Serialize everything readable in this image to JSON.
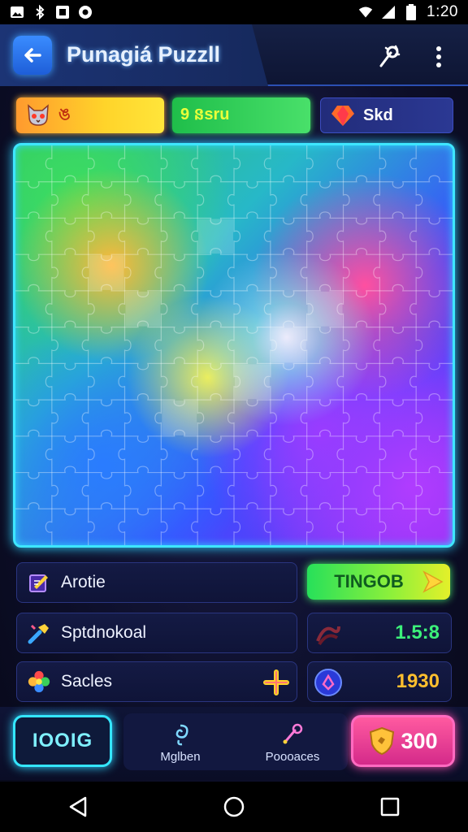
{
  "status_bar": {
    "time": "1:20",
    "icons": [
      "image-icon",
      "bluetooth-icon",
      "gallery-icon",
      "location-icon",
      "wifi-icon",
      "signal-icon",
      "battery-icon"
    ]
  },
  "header": {
    "title": "Punagiá Puzzll",
    "back_icon": "arrow-left-icon",
    "hint_icon": "wand-icon",
    "menu_icon": "more-vertical-icon"
  },
  "tabs": [
    {
      "label": "ঙ",
      "icon": "cat-icon"
    },
    {
      "label": "9 នsru",
      "icon": ""
    },
    {
      "label": "Skd",
      "icon": "heart-gem-icon"
    }
  ],
  "puzzle": {
    "grid": {
      "cols": 12,
      "rows": 11
    }
  },
  "stats": [
    {
      "label": "Arotie",
      "icon": "edit-icon"
    },
    {
      "label": "Sptdnokoal",
      "icon": "hammer-icon"
    },
    {
      "label": "Sacles",
      "icon": "flower-icon"
    }
  ],
  "go_button": {
    "label": "TINGOB"
  },
  "values": [
    {
      "value": "1.5:8",
      "icon": "wave-icon"
    },
    {
      "value": "1930",
      "icon": "badge-icon"
    }
  ],
  "bottom_bar": {
    "left_label": "IOOIG",
    "items": [
      {
        "label": "Mglben",
        "icon": "spiral-icon"
      },
      {
        "label": "Poooaces",
        "icon": "brush-icon"
      }
    ],
    "coins": "300",
    "coins_icon": "shield-coin-icon"
  },
  "colors": {
    "accent_cyan": "#3ee6ff",
    "accent_pink": "#ff4fb0",
    "value_green": "#3cf07a",
    "value_orange": "#ffbf2e"
  }
}
